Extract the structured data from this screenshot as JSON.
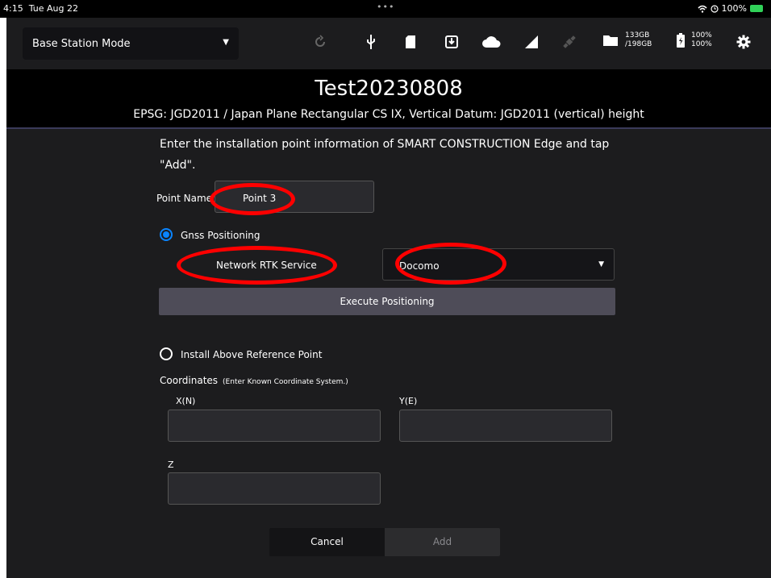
{
  "status_bar": {
    "time": "4:15",
    "date": "Tue Aug 22",
    "dots": "•••",
    "battery": "100%"
  },
  "toolbar": {
    "mode_select": "Base Station Mode",
    "storage_used": "133GB",
    "storage_total": "/198GB",
    "battery_1": "100%",
    "battery_2": "100%"
  },
  "header": {
    "title": "Test20230808",
    "subtitle": "EPSG: JGD2011 / Japan Plane Rectangular CS IX, Vertical Datum: JGD2011 (vertical) height"
  },
  "form": {
    "instruction": "Enter the installation point information of SMART CONSTRUCTION Edge and tap \"Add\".",
    "point_name_label": "Point Name",
    "point_name_value": "Point 3",
    "gnss_option": "Gnss Positioning",
    "gnss_selected": true,
    "network_rtk_label": "Network RTK Service",
    "provider_value": "Docomo",
    "execute_button": "Execute Positioning",
    "install_option": "Install Above Reference Point",
    "coordinates_label": "Coordinates",
    "coordinates_hint": "(Enter Known Coordinate System.)",
    "x_label": "X(N)",
    "y_label": "Y(E)",
    "z_label": "Z",
    "x_value": "",
    "y_value": "",
    "z_value": "",
    "cancel_button": "Cancel",
    "add_button": "Add"
  },
  "icons": [
    "wifi-icon",
    "alarm-icon",
    "battery-charging-icon",
    "sync-icon",
    "usb-icon",
    "sd-card-icon",
    "download-icon",
    "cloud-icon",
    "signal-icon",
    "satellite-icon",
    "folder-icon",
    "device-battery-icon",
    "gear-icon",
    "dropdown-caret-icon"
  ],
  "colors": {
    "background": "#1c1c1e",
    "accent": "#0a84ff",
    "annotation": "#ff0000",
    "execute_button": "#4e4c58"
  }
}
